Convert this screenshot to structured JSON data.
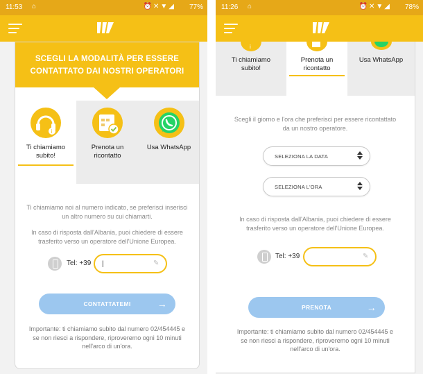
{
  "left": {
    "status": {
      "time": "11:53",
      "battery": "77%"
    },
    "header_title_line1": "SCEGLI LA MODALITÀ PER ESSERE",
    "header_title_line2": "CONTATTATO DAI NOSTRI OPERATORI",
    "options": [
      {
        "label_line1": "Ti chiamiamo",
        "label_line2": "subito!"
      },
      {
        "label_line1": "Prenota un",
        "label_line2": "ricontatto"
      },
      {
        "label_line1": "Usa WhatsApp",
        "label_line2": ""
      }
    ],
    "intro_line1": "Ti chiamiamo noi al numero indicato, se preferisci inserisci",
    "intro_line2": "un altro numero su cui chiamarti.",
    "albania_line1": "In caso di risposta dall'Albania, puoi chiedere di essere",
    "albania_line2": "trasferito verso un operatore dell'Unione Europea.",
    "tel_prefix": "Tel: +39",
    "tel_value": "|",
    "cta_label": "CONTATTATEMI",
    "note_line1": "Importante: ti chiamiamo subito dal numero 02/454445 e",
    "note_line2": "se non riesci a rispondere, riproveremo ogni 10 minuti",
    "note_line3": "nell'arco di un'ora."
  },
  "right": {
    "status": {
      "time": "11:26",
      "battery": "78%"
    },
    "options": [
      {
        "label_line1": "Ti chiamiamo",
        "label_line2": "subito!"
      },
      {
        "label_line1": "Prenota un",
        "label_line2": "ricontatto"
      },
      {
        "label_line1": "Usa WhatsApp",
        "label_line2": ""
      }
    ],
    "intro_line1": "Scegli il giorno e l'ora che preferisci per essere ricontattato",
    "intro_line2": "da un nostro operatore.",
    "date_select": "SELEZIONA LA DATA",
    "time_select": "SELEZIONA L'ORA",
    "albania_line1": "In caso di risposta dall'Albania, puoi chiedere di essere",
    "albania_line2": "trasferito verso un operatore dell'Unione Europea.",
    "tel_prefix": "Tel: +39",
    "cta_label": "PRENOTA",
    "note_line1": "Importante: ti chiamiamo subito dal numero 02/454445 e",
    "note_line2": "se non riesci a rispondere, riproveremo ogni 10 minuti",
    "note_line3": "nell'arco di un'ora."
  },
  "colors": {
    "brand_yellow": "#f5c016",
    "status_orange": "#e6a818",
    "cta_blue": "#9cc7ef",
    "whatsapp_green": "#25d366"
  },
  "icons": [
    "menu-icon",
    "brand-logo",
    "headset-icon",
    "calendar-icon",
    "whatsapp-icon",
    "phone-icon",
    "pencil-icon",
    "arrow-right-icon",
    "sort-icon"
  ]
}
